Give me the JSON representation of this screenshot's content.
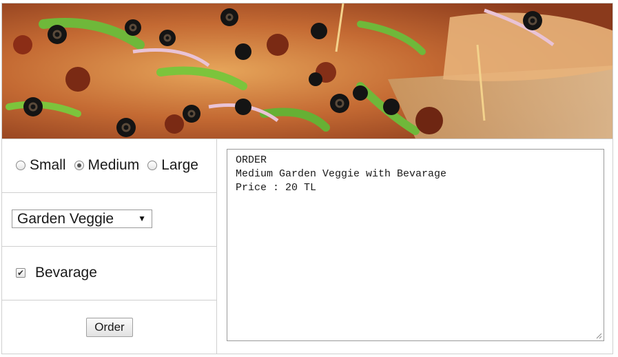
{
  "sizes": {
    "options": [
      {
        "label": "Small",
        "checked": false
      },
      {
        "label": "Medium",
        "checked": true
      },
      {
        "label": "Large",
        "checked": false
      }
    ]
  },
  "pizza_select": {
    "selected": "Garden Veggie"
  },
  "beverage": {
    "label": "Bevarage",
    "checked": true
  },
  "order_button": {
    "label": "Order"
  },
  "order_output": {
    "line1": "ORDER",
    "line2": "Medium Garden Veggie with Bevarage",
    "line3": "Price : 20 TL"
  },
  "banner": {
    "image": "pizza-photo"
  }
}
